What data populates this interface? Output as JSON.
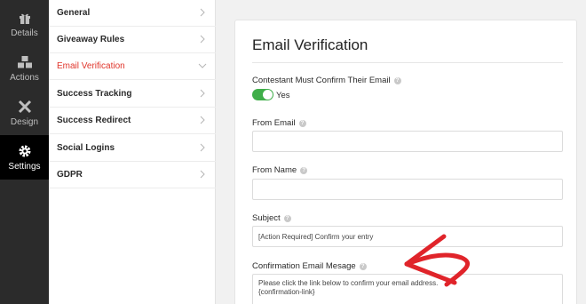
{
  "rail": {
    "items": [
      {
        "label": "Details",
        "icon": "gift-icon"
      },
      {
        "label": "Actions",
        "icon": "cubes-icon"
      },
      {
        "label": "Design",
        "icon": "brush-ruler-icon"
      },
      {
        "label": "Settings",
        "icon": "gear-icon"
      }
    ],
    "active": "Settings"
  },
  "submenu": {
    "items": [
      {
        "label": "General"
      },
      {
        "label": "Giveaway Rules"
      },
      {
        "label": "Email Verification"
      },
      {
        "label": "Success Tracking"
      },
      {
        "label": "Success Redirect"
      },
      {
        "label": "Social Logins"
      },
      {
        "label": "GDPR"
      }
    ],
    "active": "Email Verification"
  },
  "card": {
    "title": "Email Verification",
    "confirm_label": "Contestant Must Confirm Their Email",
    "confirm_toggle_text": "Yes",
    "confirm_toggle_on": true,
    "from_email_label": "From Email",
    "from_email_value": "",
    "from_name_label": "From Name",
    "from_name_value": "",
    "subject_label": "Subject",
    "subject_value": "[Action Required] Confirm your entry",
    "message_label": "Confirmation Email Mesage",
    "message_line1": "Please click the link below to confirm your email address.",
    "message_line2": "{confirmation-link}"
  },
  "colors": {
    "accent_red": "#e0352b",
    "toggle_green": "#3fae49",
    "rail_bg": "#2b2b2b",
    "annotation_arrow": "#e0242a"
  }
}
